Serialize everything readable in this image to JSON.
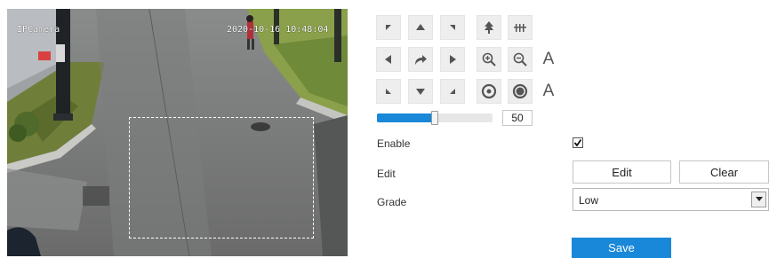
{
  "camera": {
    "osd_name": "IPCamera",
    "osd_time": "2020-10-16 10:48:04",
    "roi_color": "#ffffff"
  },
  "ptz": {
    "buttons": [
      {
        "name": "pan-up-left-icon"
      },
      {
        "name": "pan-up-icon"
      },
      {
        "name": "pan-up-right-icon"
      },
      {
        "name": "focus-near-icon"
      },
      {
        "name": "focus-far-icon"
      },
      {
        "name": "pan-left-icon"
      },
      {
        "name": "auto-scan-icon"
      },
      {
        "name": "pan-right-icon"
      },
      {
        "name": "zoom-in-icon"
      },
      {
        "name": "zoom-out-icon"
      },
      {
        "name": "pan-down-left-icon"
      },
      {
        "name": "pan-down-icon"
      },
      {
        "name": "pan-down-right-icon"
      },
      {
        "name": "iris-open-icon"
      },
      {
        "name": "iris-close-icon"
      }
    ],
    "auto_label": "A"
  },
  "speed": {
    "value": "50",
    "fraction": 0.5,
    "accent": "#1a88d8"
  },
  "form": {
    "enable_label": "Enable",
    "enable_checked": true,
    "edit_label": "Edit",
    "edit_button": "Edit",
    "clear_button": "Clear",
    "grade_label": "Grade",
    "grade_value": "Low",
    "save_button": "Save"
  }
}
